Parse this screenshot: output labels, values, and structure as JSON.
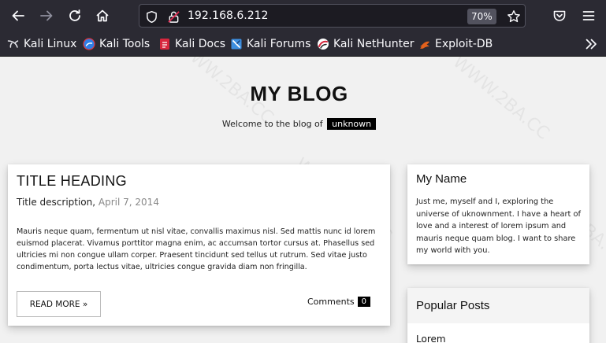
{
  "browser": {
    "url": "192.168.6.212",
    "zoom": "70%",
    "bookmarks": [
      "Kali Linux",
      "Kali Tools",
      "Kali Docs",
      "Kali Forums",
      "Kali NetHunter",
      "Exploit-DB"
    ],
    "icons": {
      "back": "arrow-left-icon",
      "forward": "arrow-right-icon",
      "reload": "reload-icon",
      "home": "home-icon",
      "shield": "shield-icon",
      "insecure_lock": "insecure-lock-icon",
      "star": "star-icon",
      "pocket": "pocket-icon",
      "menu": "hamburger-menu-icon",
      "more_bookmarks": "chevron-double-right-icon"
    }
  },
  "blog": {
    "title": "MY BLOG",
    "welcome_text": "Welcome to the blog of",
    "welcome_user": "unknown",
    "watermark": "WWW.2BA.CC"
  },
  "post": {
    "title": "TITLE HEADING",
    "description": "Title description,",
    "date": "April 7, 2014",
    "body": "Mauris neque quam, fermentum ut nisl vitae, convallis maximus nisl. Sed mattis nunc id lorem euismod placerat. Vivamus porttitor magna enim, ac accumsan tortor cursus at. Phasellus sed ultricies mi non congue ullam corper. Praesent tincidunt sed tellus ut rutrum. Sed vitae justo condimentum, porta lectus vitae, ultricies congue gravida diam non fringilla.",
    "read_more": "READ MORE »",
    "comments_label": "Comments",
    "comments_count": "0"
  },
  "sidebar": {
    "name_title": "My Name",
    "name_body": "Just me, myself and I, exploring the universe of uknownment. I have a heart of love and a interest of lorem ipsum and mauris neque quam blog. I want to share my world with you.",
    "popular_title": "Popular Posts",
    "popular_first": "Lorem"
  },
  "colors": {
    "chrome_bg": "#2b2a33",
    "urlbar_bg": "#1c1b22",
    "page_bg": "#f1f1f1",
    "card_bg": "#ffffff",
    "badge_bg": "#000000"
  }
}
